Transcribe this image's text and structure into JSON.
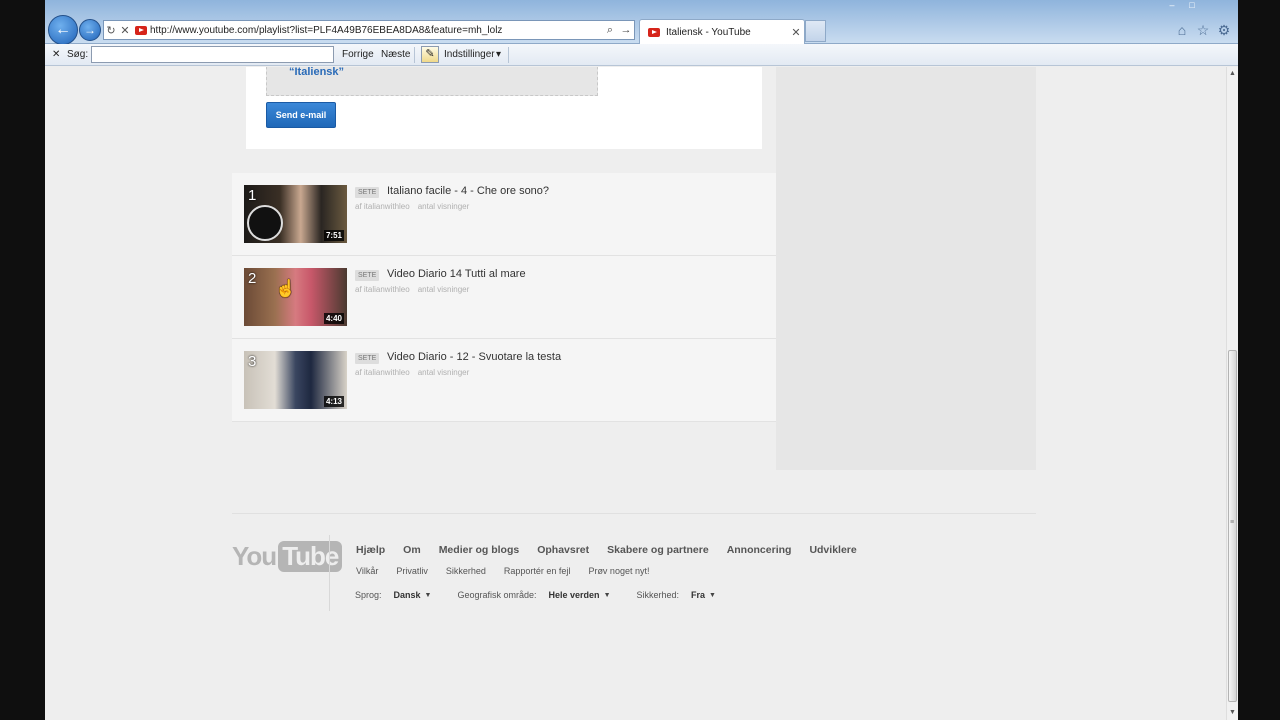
{
  "browser": {
    "url": "http://www.youtube.com/playlist?list=PLF4A49B76EBEA8DA8&feature=mh_lolz",
    "tab_title": "Italiensk - YouTube",
    "back_icon": "←",
    "forward_icon": "→",
    "refresh_icon": "↻",
    "stop_icon": "✕",
    "search_icon": "⌕",
    "go_icon": "→",
    "tab_close_icon": "✕",
    "home_icon": "⌂",
    "favorites_icon": "☆",
    "tools_icon": "⚙",
    "minimize_icon": "–",
    "maximize_icon": "□"
  },
  "findbar": {
    "close_icon": "✕",
    "label": "Søg:",
    "input_value": "",
    "prev": "Forrige",
    "next": "Næste",
    "options": "Indstillinger",
    "options_caret": "▾"
  },
  "share": {
    "playlist_name": "“Italiensk”",
    "send_button": "Send e-mail"
  },
  "videos": [
    {
      "num": "1",
      "badge": "SETE",
      "title": "Italiano facile - 4 - Che ore sono?",
      "author": "af italianwithleo",
      "views": "antal visninger",
      "duration": "7:51"
    },
    {
      "num": "2",
      "badge": "SETE",
      "title": "Video Diario 14 Tutti al mare",
      "author": "af italianwithleo",
      "views": "antal visninger",
      "duration": "4:40"
    },
    {
      "num": "3",
      "badge": "SETE",
      "title": "Video Diario - 12 - Svuotare la testa",
      "author": "af italianwithleo",
      "views": "antal visninger",
      "duration": "4:13"
    }
  ],
  "footer": {
    "logo_you": "You",
    "logo_tube": "Tube",
    "links_primary": [
      "Hjælp",
      "Om",
      "Medier og blogs",
      "Ophavsret",
      "Skabere og partnere",
      "Annoncering",
      "Udviklere"
    ],
    "links_secondary": [
      "Vilkår",
      "Privatliv",
      "Sikkerhed",
      "Rapportér en fejl",
      "Prøv noget nyt!"
    ],
    "language_label": "Sprog:",
    "language_value": "Dansk",
    "region_label": "Geografisk område:",
    "region_value": "Hele verden",
    "safety_label": "Sikkerhed:",
    "safety_value": "Fra",
    "caret": "▼"
  },
  "scrollbar": {
    "up_icon": "▲",
    "down_icon": "▼",
    "grip": "≡"
  },
  "cursor_icon": "☝",
  "colors": {
    "accent_blue": "#2a6bb8",
    "youtube_red": "#d6241a",
    "send_button": "#1f68b8"
  }
}
